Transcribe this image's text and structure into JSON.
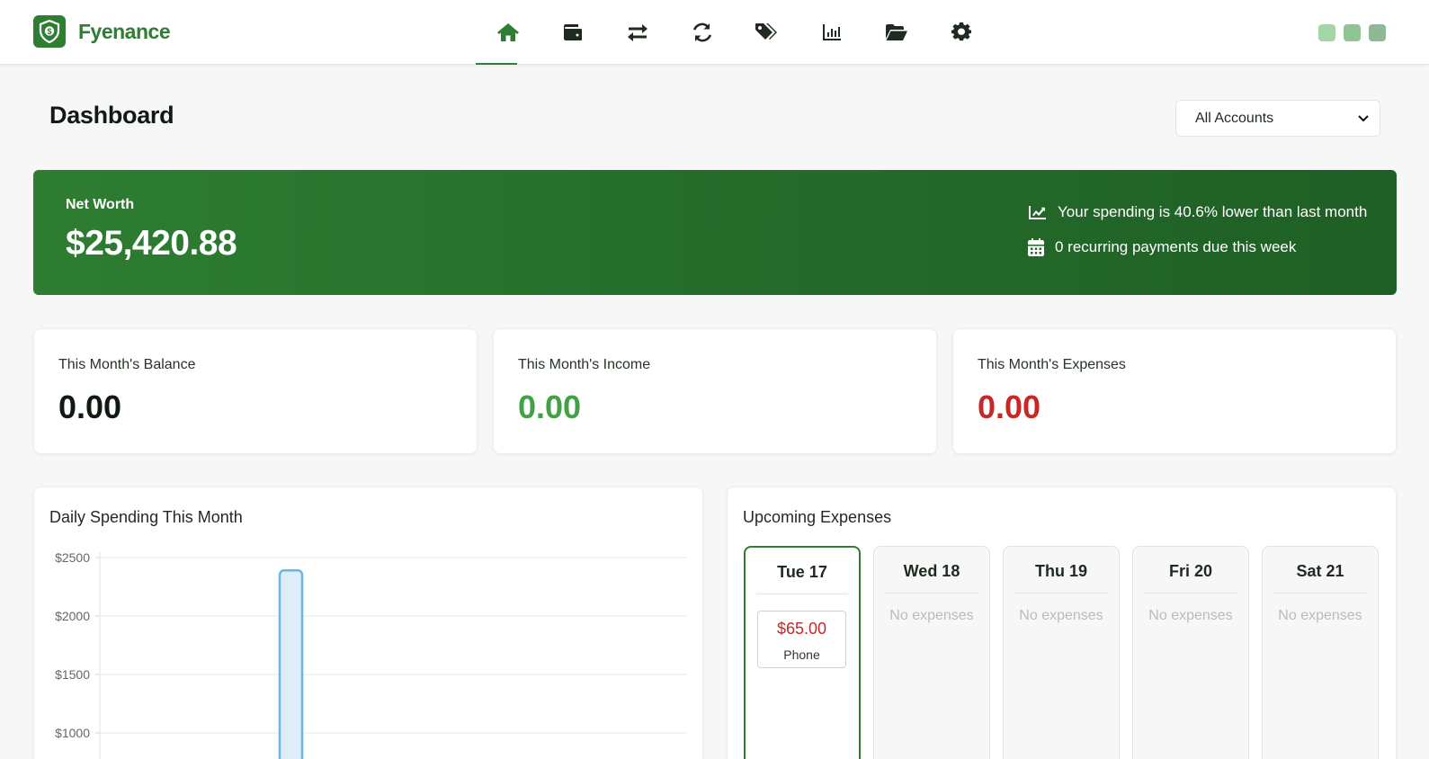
{
  "app": {
    "name": "Fyenance",
    "accent": "#2e7d32"
  },
  "nav": {
    "items": [
      {
        "icon": "home-icon",
        "active": true
      },
      {
        "icon": "wallet-icon"
      },
      {
        "icon": "transfer-arrows-icon"
      },
      {
        "icon": "recurring-sync-icon"
      },
      {
        "icon": "tags-icon"
      },
      {
        "icon": "bar-chart-icon"
      },
      {
        "icon": "folder-open-icon"
      },
      {
        "icon": "gear-icon"
      }
    ],
    "window_dots": [
      "#a5d6a7",
      "#8fc594",
      "#8fb894"
    ]
  },
  "page": {
    "title": "Dashboard",
    "account_select": {
      "value": "All Accounts"
    }
  },
  "net_worth": {
    "label": "Net Worth",
    "value": "$25,420.88",
    "insights": [
      {
        "icon": "trend-chart-icon",
        "text": "Your spending is 40.6% lower than last month"
      },
      {
        "icon": "calendar-icon",
        "text": "0 recurring payments due this week"
      }
    ]
  },
  "stats": [
    {
      "label": "This Month's Balance",
      "value": "0.00",
      "color": "#111a12"
    },
    {
      "label": "This Month's Income",
      "value": "0.00",
      "color": "#43a047"
    },
    {
      "label": "This Month's Expenses",
      "value": "0.00",
      "color": "#c62828"
    }
  ],
  "daily_spending": {
    "title": "Daily Spending This Month"
  },
  "chart_data": {
    "type": "bar",
    "ylim": [
      0,
      2500
    ],
    "y_ticks": [
      "$2500",
      "$2000",
      "$1500",
      "$1000"
    ],
    "grid": true,
    "series": [
      {
        "values": [
          2390
        ]
      }
    ],
    "bar_color": "#6cb4e6"
  },
  "upcoming": {
    "title": "Upcoming Expenses",
    "days": [
      {
        "label": "Tue 17",
        "today": true,
        "expenses": [
          {
            "amount": "$65.00",
            "name": "Phone"
          }
        ]
      },
      {
        "label": "Wed 18",
        "empty": "No expenses"
      },
      {
        "label": "Thu 19",
        "empty": "No expenses"
      },
      {
        "label": "Fri 20",
        "empty": "No expenses"
      },
      {
        "label": "Sat 21",
        "empty": "No expenses"
      }
    ]
  }
}
